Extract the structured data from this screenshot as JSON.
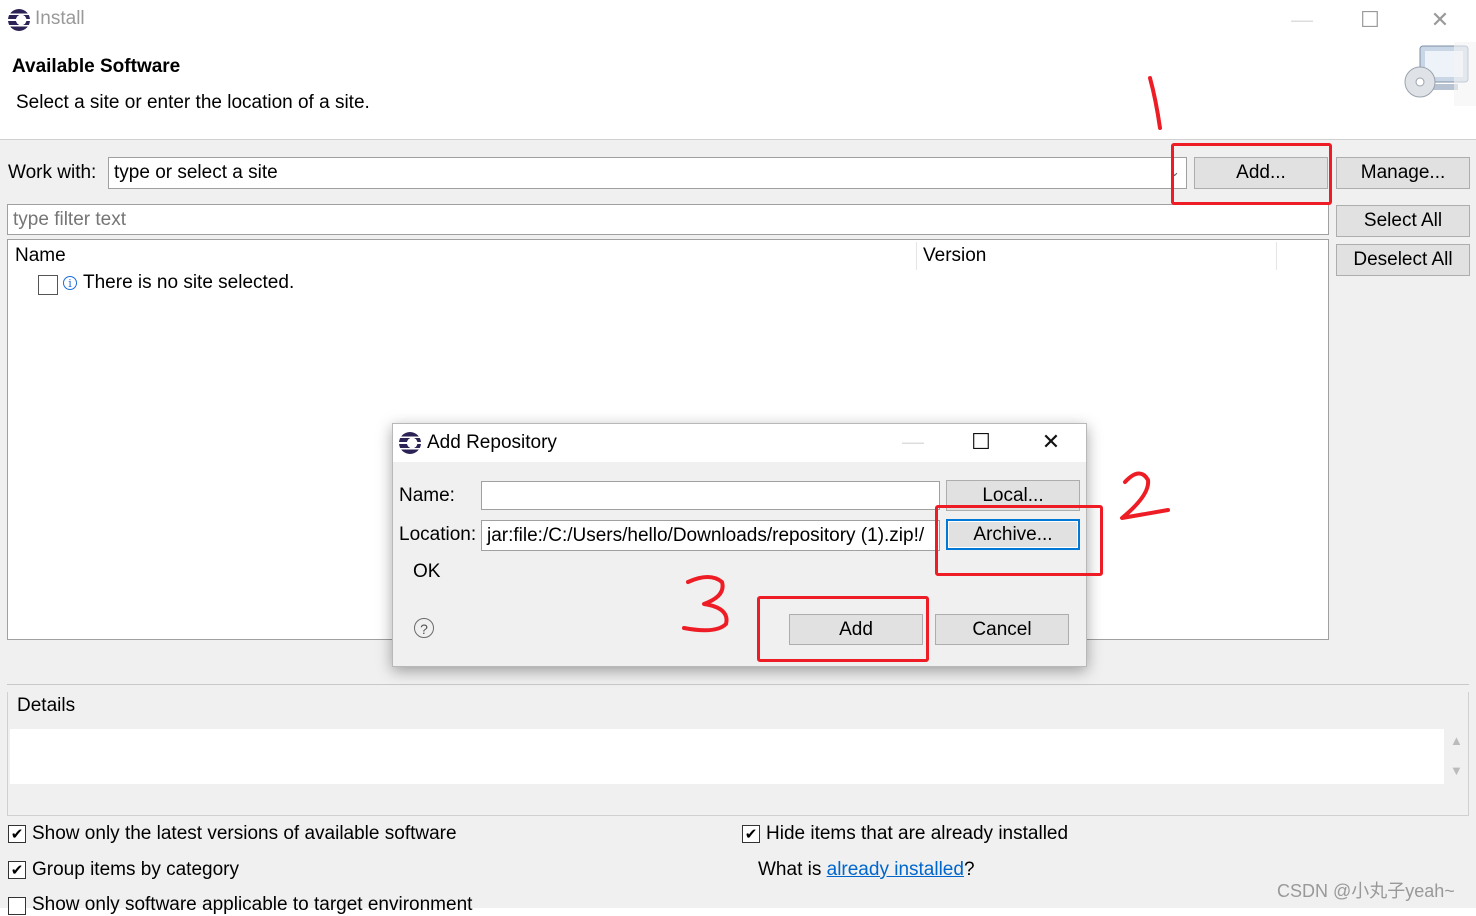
{
  "window": {
    "title": "Install",
    "heading": "Available Software",
    "subtitle": "Select a site or enter the location of a site."
  },
  "work_with": {
    "label": "Work with:",
    "value": "type or select a site",
    "add_button": "Add...",
    "manage_button": "Manage..."
  },
  "filter": {
    "placeholder": "type filter text"
  },
  "side_buttons": {
    "select_all": "Select All",
    "deselect_all": "Deselect All"
  },
  "table": {
    "columns": [
      "Name",
      "Version"
    ],
    "rows": [
      {
        "label": "There is no site selected."
      }
    ]
  },
  "details": {
    "label": "Details"
  },
  "options": {
    "show_latest": "Show only the latest versions of available software",
    "group_by_category": "Group items by category",
    "show_applicable": "Show only software applicable to target environment",
    "hide_installed": "Hide items that are already installed",
    "what_is_prefix": "What is ",
    "already_installed_link": "already installed",
    "what_is_suffix": "?"
  },
  "dialog": {
    "title": "Add Repository",
    "name_label": "Name:",
    "name_value": "",
    "location_label": "Location:",
    "location_value": "jar:file:/C:/Users/hello/Downloads/repository (1).zip!/",
    "local_button": "Local...",
    "archive_button": "Archive...",
    "status": "OK",
    "add_button": "Add",
    "cancel_button": "Cancel"
  },
  "annotations": {
    "step1": "1",
    "step2": "2",
    "step3": "3"
  },
  "watermark": "CSDN @小丸子yeah~",
  "colors": {
    "annotation_red": "#ee1c25",
    "link_blue": "#0066cc",
    "default_button_border": "#0078d7"
  }
}
